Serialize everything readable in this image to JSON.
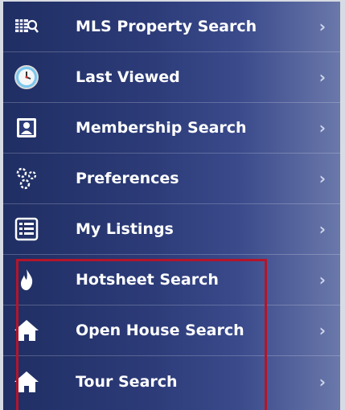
{
  "menu": {
    "items": [
      {
        "label": "MLS Property Search",
        "icon": "search-grid-icon"
      },
      {
        "label": "Last Viewed",
        "icon": "clock-icon"
      },
      {
        "label": "Membership Search",
        "icon": "contact-card-icon"
      },
      {
        "label": "Preferences",
        "icon": "gears-icon"
      },
      {
        "label": "My Listings",
        "icon": "list-icon"
      },
      {
        "label": "Hotsheet Search",
        "icon": "flame-icon"
      },
      {
        "label": "Open House Search",
        "icon": "house-icon"
      },
      {
        "label": "Tour Search",
        "icon": "house-icon"
      }
    ],
    "chevron": "›"
  },
  "colors": {
    "menu_dark": "#1f2e63",
    "menu_light": "#6a78aa",
    "highlight_border": "#b4152a",
    "text": "#ffffff"
  }
}
